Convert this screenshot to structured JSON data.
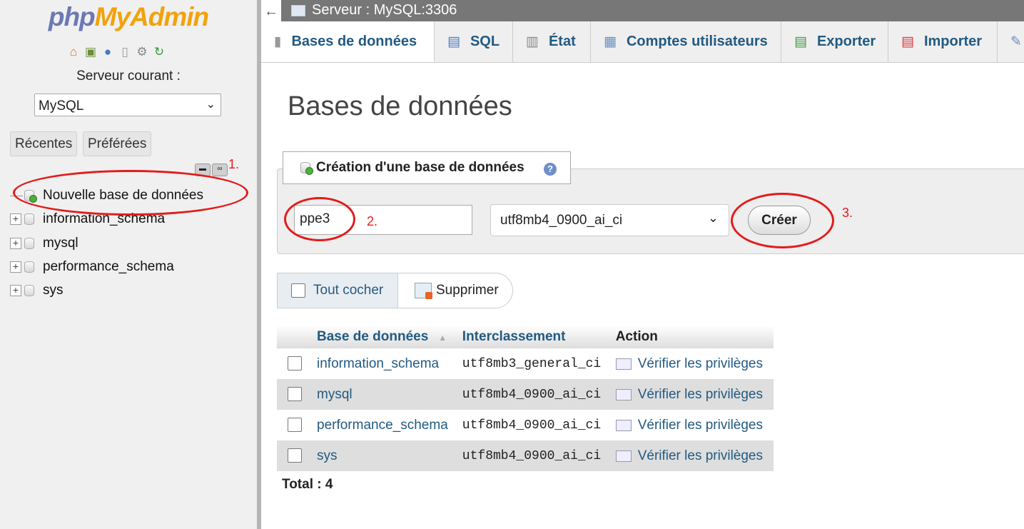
{
  "sidebar": {
    "logo_php": "php",
    "logo_admin": "MyAdmin",
    "server_label": "Serveur courant :",
    "server_select": "MySQL",
    "recent_label": "Récentes",
    "favorites_label": "Préférées",
    "new_db_label": "Nouvelle base de données",
    "databases": [
      "information_schema",
      "mysql",
      "performance_schema",
      "sys"
    ]
  },
  "topbar": {
    "back_symbol": "←",
    "breadcrumb": "Serveur : MySQL:3306"
  },
  "tabs": [
    {
      "label": "Bases de données",
      "icon": "database-icon"
    },
    {
      "label": "SQL",
      "icon": "sql-icon"
    },
    {
      "label": "État",
      "icon": "status-icon"
    },
    {
      "label": "Comptes utilisateurs",
      "icon": "users-icon"
    },
    {
      "label": "Exporter",
      "icon": "export-icon"
    },
    {
      "label": "Importer",
      "icon": "import-icon"
    }
  ],
  "main": {
    "title": "Bases de données",
    "create_legend": "Création d'une base de données",
    "db_name_value": "ppe3",
    "collation_value": "utf8mb4_0900_ai_ci",
    "create_button": "Créer",
    "check_all": "Tout cocher",
    "delete_button": "Supprimer",
    "table_headers": {
      "database": "Base de données",
      "collation": "Interclassement",
      "action": "Action"
    },
    "rows": [
      {
        "name": "information_schema",
        "collation": "utf8mb3_general_ci",
        "action": "Vérifier les privilèges"
      },
      {
        "name": "mysql",
        "collation": "utf8mb4_0900_ai_ci",
        "action": "Vérifier les privilèges"
      },
      {
        "name": "performance_schema",
        "collation": "utf8mb4_0900_ai_ci",
        "action": "Vérifier les privilèges"
      },
      {
        "name": "sys",
        "collation": "utf8mb4_0900_ai_ci",
        "action": "Vérifier les privilèges"
      }
    ],
    "total": "Total : 4"
  },
  "annotations": {
    "one": "1.",
    "two": "2.",
    "three": "3.",
    "color": "#e31c1c"
  },
  "colors": {
    "link": "#235a81",
    "logo_blue": "#6c78b5",
    "logo_orange": "#f2a20c"
  }
}
